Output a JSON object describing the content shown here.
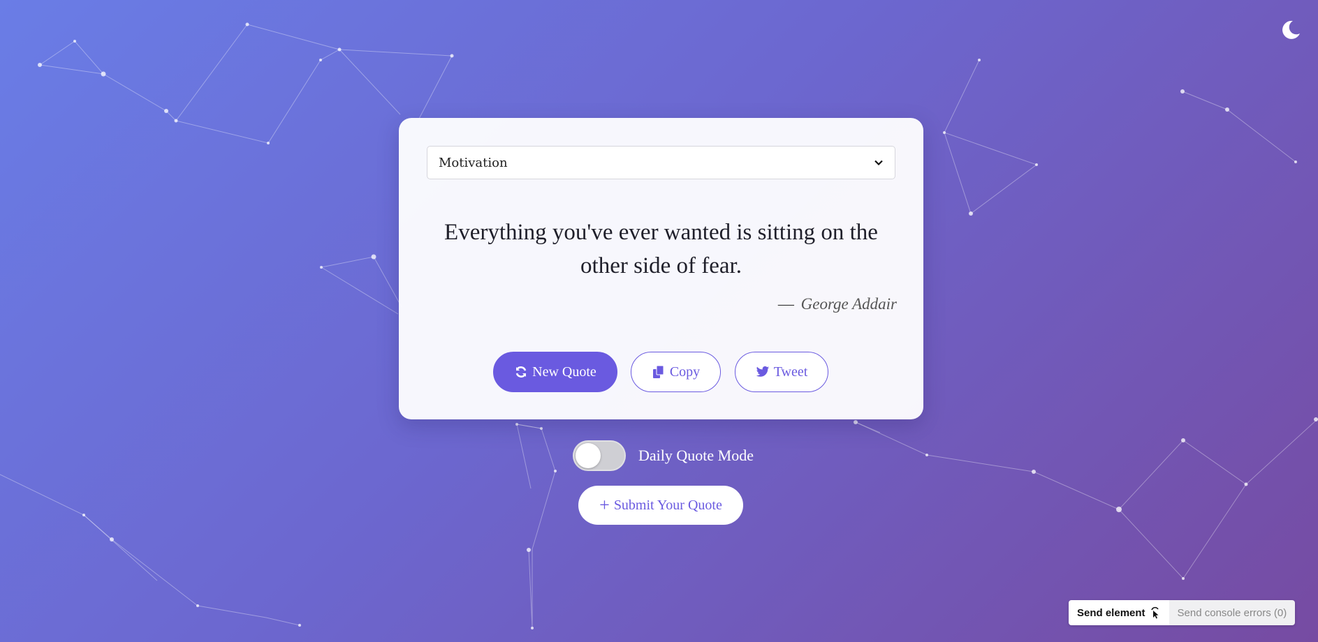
{
  "theme": {
    "toggle_icon": "moon-icon",
    "background_gradient": [
      "#6a7de6",
      "#764ba2"
    ],
    "accent": "#6a5ae0"
  },
  "quote_card": {
    "category_selected": "Motivation",
    "quote": "Everything you've ever wanted is sitting on the other side of fear.",
    "author_dash": "—",
    "author": "George Addair",
    "buttons": {
      "new_quote": "New Quote",
      "copy": "Copy",
      "tweet": "Tweet"
    }
  },
  "daily_mode": {
    "label": "Daily Quote Mode",
    "enabled": false
  },
  "submit": {
    "label": "Submit Your Quote"
  },
  "devtools_bar": {
    "send_element": "Send element",
    "send_console_errors": "Send console errors (0)"
  }
}
